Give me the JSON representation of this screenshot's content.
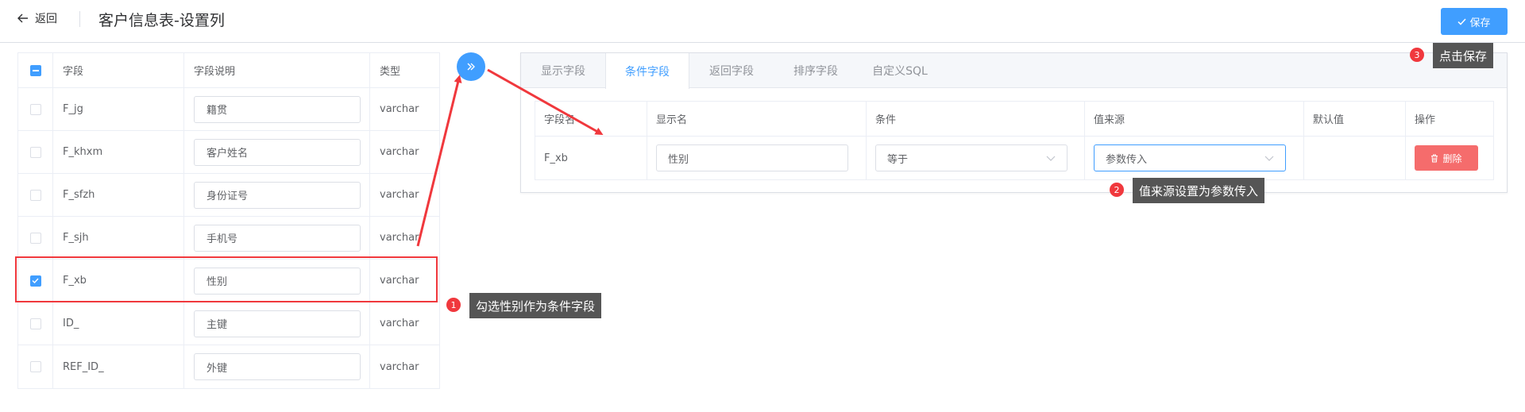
{
  "header": {
    "back_label": "返回",
    "title": "客户信息表-设置列",
    "save_label": "保存"
  },
  "field_table": {
    "headers": {
      "field": "字段",
      "desc": "字段说明",
      "type": "类型"
    },
    "rows": [
      {
        "field": "F_jg",
        "desc": "籍贯",
        "type": "varchar",
        "checked": false
      },
      {
        "field": "F_khxm",
        "desc": "客户姓名",
        "type": "varchar",
        "checked": false
      },
      {
        "field": "F_sfzh",
        "desc": "身份证号",
        "type": "varchar",
        "checked": false
      },
      {
        "field": "F_sjh",
        "desc": "手机号",
        "type": "varchar",
        "checked": false
      },
      {
        "field": "F_xb",
        "desc": "性别",
        "type": "varchar",
        "checked": true
      },
      {
        "field": "ID_",
        "desc": "主键",
        "type": "varchar",
        "checked": false
      },
      {
        "field": "REF_ID_",
        "desc": "外键",
        "type": "varchar",
        "checked": false
      }
    ]
  },
  "tabs": [
    {
      "label": "显示字段",
      "active": false
    },
    {
      "label": "条件字段",
      "active": true
    },
    {
      "label": "返回字段",
      "active": false
    },
    {
      "label": "排序字段",
      "active": false
    },
    {
      "label": "自定义SQL",
      "active": false
    }
  ],
  "condition_table": {
    "headers": [
      "字段名",
      "显示名",
      "条件",
      "值来源",
      "默认值",
      "操作"
    ],
    "row": {
      "field": "F_xb",
      "display_name": "性别",
      "condition": "等于",
      "value_source": "参数传入",
      "default": "",
      "delete_label": "删除"
    }
  },
  "annotations": [
    {
      "num": "1",
      "text": "勾选性别作为条件字段"
    },
    {
      "num": "2",
      "text": "值来源设置为参数传入"
    },
    {
      "num": "3",
      "text": "点击保存"
    }
  ],
  "colors": {
    "primary": "#409eff",
    "danger": "#f56c6c",
    "annotation": "#f0383d",
    "tooltip": "#555555"
  }
}
